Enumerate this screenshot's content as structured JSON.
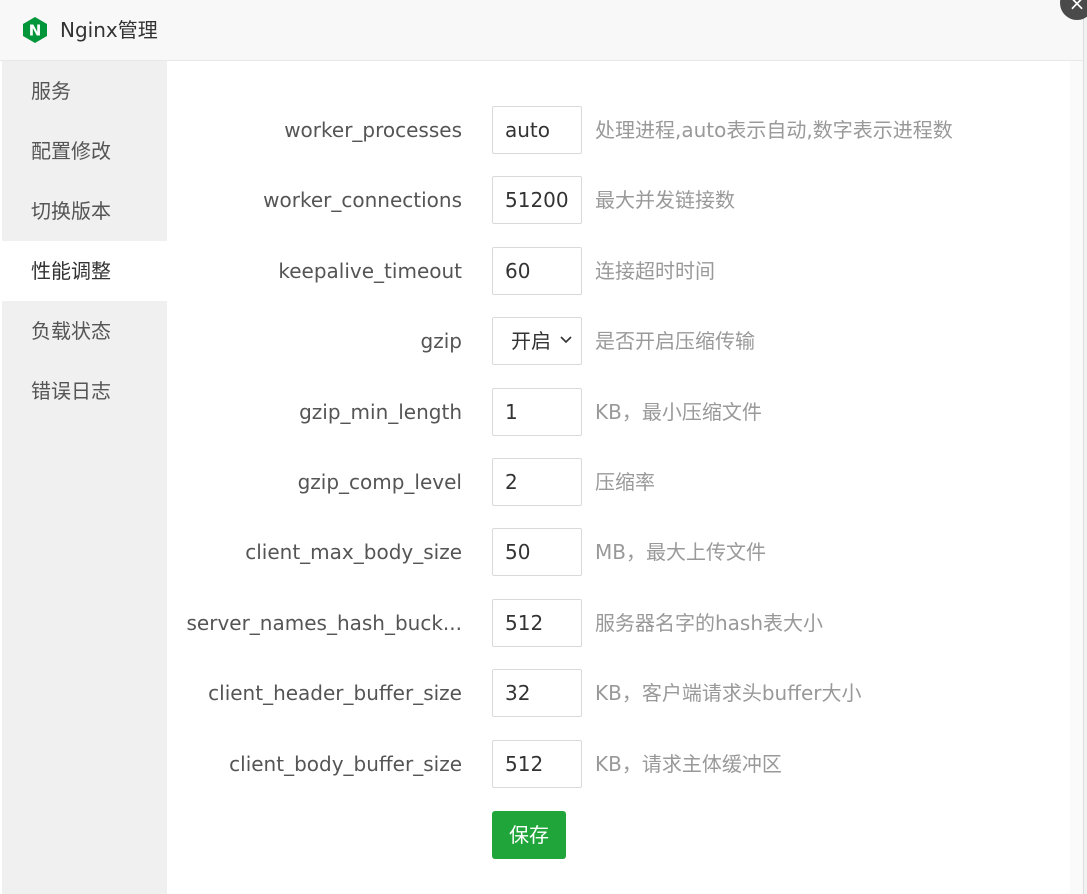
{
  "window": {
    "title": "Nginx管理",
    "close_symbol": "×",
    "logo_icon": "nginx-logo",
    "logo_letter": "N"
  },
  "sidebar": {
    "active_index": 3,
    "items": [
      {
        "label": "服务"
      },
      {
        "label": "配置修改"
      },
      {
        "label": "切换版本"
      },
      {
        "label": "性能调整"
      },
      {
        "label": "负载状态"
      },
      {
        "label": "错误日志"
      }
    ]
  },
  "form": {
    "fields": [
      {
        "label": "worker_processes",
        "value": "auto",
        "hint": "处理进程,auto表示自动,数字表示进程数"
      },
      {
        "label": "worker_connections",
        "value": "51200",
        "hint": "最大并发链接数"
      },
      {
        "label": "keepalive_timeout",
        "value": "60",
        "hint": "连接超时时间"
      },
      {
        "label": "gzip",
        "value": "开启",
        "hint": "是否开启压缩传输",
        "type": "select"
      },
      {
        "label": "gzip_min_length",
        "value": "1",
        "hint": "KB，最小压缩文件"
      },
      {
        "label": "gzip_comp_level",
        "value": "2",
        "hint": "压缩率"
      },
      {
        "label": "client_max_body_size",
        "value": "50",
        "hint": "MB，最大上传文件"
      },
      {
        "label": "server_names_hash_buck...",
        "value": "512",
        "hint": "服务器名字的hash表大小"
      },
      {
        "label": "client_header_buffer_size",
        "value": "32",
        "hint": "KB，客户端请求头buffer大小"
      },
      {
        "label": "client_body_buffer_size",
        "value": "512",
        "hint": "KB，请求主体缓冲区"
      }
    ],
    "save_label": "保存"
  },
  "colors": {
    "accent": "#20a53a",
    "hint_text": "#999999",
    "label_text": "#555555",
    "sidebar_bg": "#f0f0f0"
  }
}
